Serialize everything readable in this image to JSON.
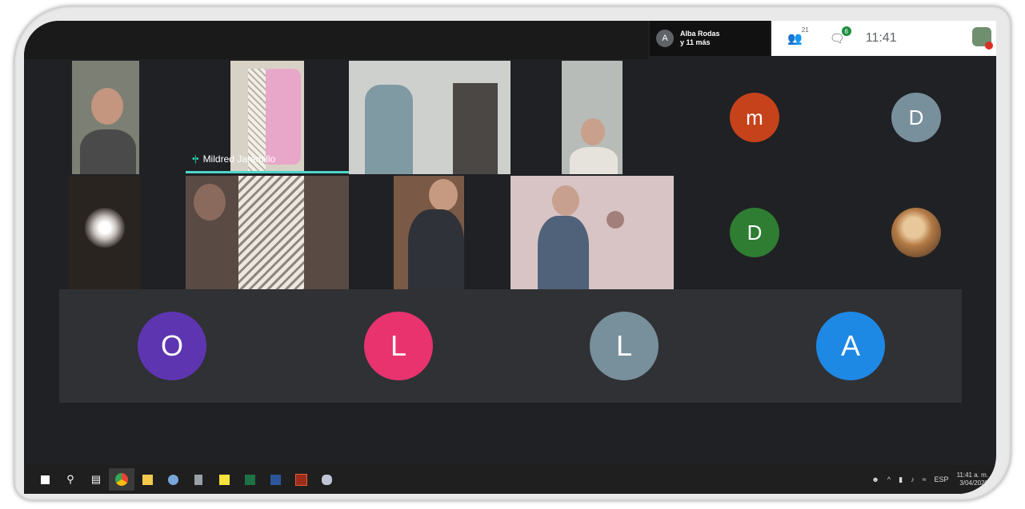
{
  "presenter": {
    "initial": "A",
    "line1": "Alba Rodas",
    "line2": "y 11 más"
  },
  "topbar": {
    "people_count": "21",
    "chat_count": "6",
    "clock": "11:41"
  },
  "tiles": {
    "speaker_name": "Mildred Jaramillo"
  },
  "avatars": {
    "top": [
      {
        "letter": "m",
        "color": "#c5421b"
      },
      {
        "letter": "D",
        "color": "#78909c"
      },
      {
        "letter": "D",
        "color": "#2e7d32"
      }
    ],
    "bottom": [
      {
        "letter": "O",
        "color": "#5e35b1"
      },
      {
        "letter": "L",
        "color": "#e8336f"
      },
      {
        "letter": "L",
        "color": "#78909c"
      },
      {
        "letter": "A",
        "color": "#1e88e5"
      }
    ]
  },
  "taskbar": {
    "icons": [
      "windows-start-icon",
      "search-icon",
      "task-view-icon",
      "chrome-icon",
      "file-explorer-icon",
      "paint-icon",
      "calculator-icon",
      "sticky-notes-icon",
      "excel-icon",
      "word-icon",
      "acrobat-icon",
      "paint-3d-icon"
    ],
    "tray_lang": "ESP",
    "tray_time": "11:41 a. m.",
    "tray_date": "3/04/2020"
  }
}
